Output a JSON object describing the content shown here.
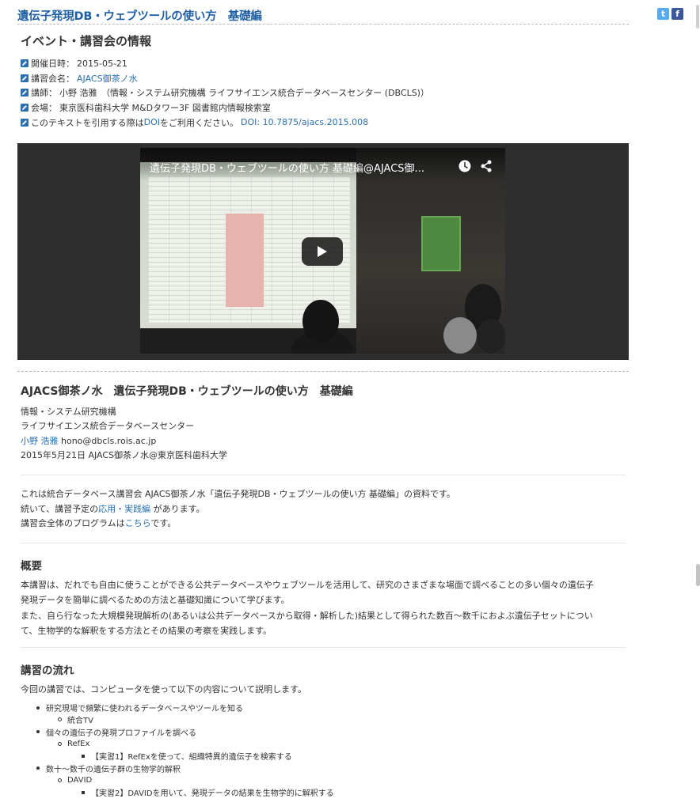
{
  "page": {
    "title": "遺伝子発現DB・ウェブツールの使い方　基礎編"
  },
  "social": {
    "twitter_glyph": "t",
    "facebook_glyph": "f",
    "twitter_color": "#55acee",
    "facebook_color": "#3b5998"
  },
  "event": {
    "heading": "イベント・講習会の情報",
    "date_label": "開催日時：",
    "date_value": "2015-05-21",
    "name_label": "講習会名：",
    "name_link": "AJACS御茶ノ水",
    "lecturer_label": "講師：",
    "lecturer_value": "小野 浩雅　（情報・システム研究機構 ライフサイエンス統合データベースセンター (DBCLS)）",
    "venue_label": "会場：",
    "venue_value": "東京医科歯科大学 M&Dタワー3F 図書館内情報検索室",
    "cite_prefix": "このテキストを引用する際は",
    "cite_doi_word": "DOI",
    "cite_middle": "をご利用ください。",
    "cite_doi_link": "DOI: 10.7875/ajacs.2015.008"
  },
  "video": {
    "title": "遺伝子発現DB・ウェブツールの使い方 基礎編@AJACS御..."
  },
  "doc": {
    "title": "AJACS御茶ノ水　遺伝子発現DB・ウェブツールの使い方　基礎編",
    "org1": "情報・システム研究機構",
    "org2": "ライフサイエンス統合データベースセンター",
    "author_link": "小野 浩雅",
    "author_email": " hono@dbcls.rois.ac.jp",
    "date_place": "2015年5月21日 AJACS御茶ノ水@東京医科歯科大学"
  },
  "intro": {
    "line1": "これは統合データベース講習会 AJACS御茶ノ水「遺伝子発現DB・ウェブツールの使い方 基礎編」の資料です。",
    "line2_prefix": "続いて、講習予定の",
    "line2_link": "応用・実践編",
    "line2_suffix": " があります。",
    "line3_prefix": "講習会全体のプログラムは",
    "line3_link": "こちら",
    "line3_suffix": "です。"
  },
  "overview": {
    "heading": "概要",
    "p1a": "本講習は、だれでも自由に使うことができる公共データベースやウェブツールを活用して、研究のさまざまな場面で調べることの多い個々の遺伝子",
    "p1b": "発現データを簡単に調べるための方法と基礎知識について学びます。",
    "p2a": "また、自ら行なった大規模発現解析の(あるいは公共データベースから取得・解析した)結果として得られた数百〜数千におよぶ遺伝子セットについ",
    "p2b": "て、生物学的な解釈をする方法とその結果の考察を実践します。"
  },
  "flow": {
    "heading": "講習の流れ",
    "intro": "今回の講習では、コンピュータを使って以下の内容について説明します。",
    "items": [
      {
        "level": 1,
        "text": "研究現場で頻繁に使われるデータベースやツールを知る"
      },
      {
        "level": 2,
        "text": "統合TV"
      },
      {
        "level": 1,
        "text": "個々の遺伝子の発現プロファイルを調べる"
      },
      {
        "level": 2,
        "text": "RefEx"
      },
      {
        "level": 3,
        "text": "【実習1】RefExを使って、組織特異的遺伝子を検索する"
      },
      {
        "level": 1,
        "text": "数十〜数千の遺伝子群の生物学的解釈"
      },
      {
        "level": 2,
        "text": "DAVID"
      },
      {
        "level": 3,
        "text": "【実習2】DAVIDを用いて、発現データの結果を生物学的に解釈する"
      }
    ]
  }
}
